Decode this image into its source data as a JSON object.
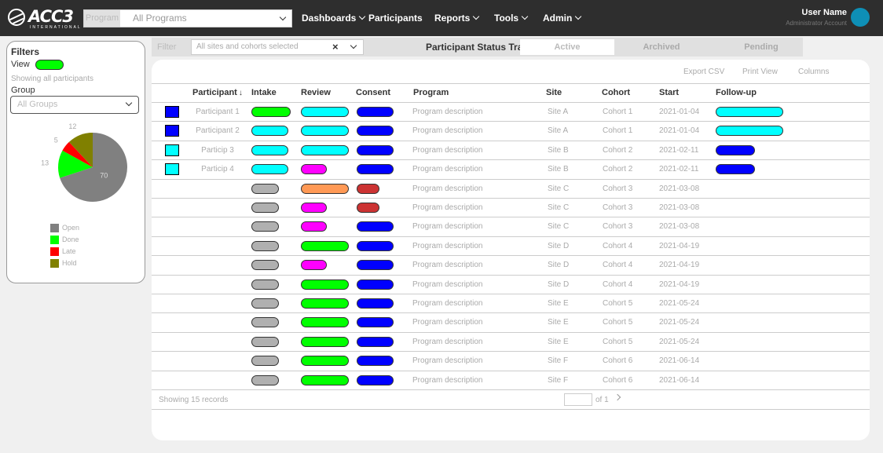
{
  "header": {
    "logo_text": "ACC3",
    "logo_subtext": "INTERNATIONAL",
    "program_label": "Program",
    "program_value": "All Programs",
    "nav": [
      {
        "label": "Dashboards",
        "has_menu": true
      },
      {
        "label": "Participants",
        "has_menu": false
      },
      {
        "label": "Reports",
        "has_menu": true
      },
      {
        "label": "Tools",
        "has_menu": true
      },
      {
        "label": "Admin",
        "has_menu": true
      }
    ],
    "user_name": "User Name",
    "user_role": "Administrator Account"
  },
  "filter_panel": {
    "title": "Filters",
    "status_key": "View",
    "status_color": "#00ff00",
    "caption": "Showing all participants",
    "group_label": "Group",
    "group_select": "All Groups",
    "pie": {
      "slices": [
        {
          "label": "Open",
          "value": 70,
          "color": "#808080"
        },
        {
          "label": "Done",
          "value": 13,
          "color": "#00ff00"
        },
        {
          "label": "Late",
          "value": 5,
          "color": "#ff0000"
        },
        {
          "label": "Hold",
          "value": 12,
          "color": "#808000"
        }
      ]
    }
  },
  "tabstrip": {
    "label": "Filter",
    "select_value": "All sites and cohorts selected",
    "clear_icon": "×",
    "title": "Participant Status Tracker",
    "tabs": [
      {
        "label": "Active",
        "active": true
      },
      {
        "label": "Archived",
        "active": false
      },
      {
        "label": "Pending",
        "active": false
      }
    ]
  },
  "table": {
    "tools": [
      "Export CSV",
      "Print View",
      "Columns"
    ],
    "columns": [
      "Participant",
      "Intake",
      "Review",
      "Consent",
      "Program",
      "Site",
      "Cohort",
      "Start",
      "Follow-up"
    ],
    "sorted_column": "Participant",
    "rows": [
      {
        "check": "#0000ff",
        "id": "Participant 1",
        "intake": "#00ff00",
        "review": "#00ffff",
        "consent": "#0000ff",
        "program": "Program description",
        "site": "Site A",
        "cohort": "Cohort 1",
        "start": "2021-01-04",
        "followup": "#00ffff"
      },
      {
        "check": "#0000ff",
        "id": "Participant 2",
        "intake": "#00ffff",
        "review": "#00ffff",
        "consent": "#0000ff",
        "program": "Program description",
        "site": "Site A",
        "cohort": "Cohort 1",
        "start": "2021-01-04",
        "followup": "#00ffff"
      },
      {
        "check": "#00ffff",
        "id": "Particip 3",
        "intake": "#00ffff",
        "review": "#00ffff",
        "consent": "#0000ff",
        "program": "Program description",
        "site": "Site B",
        "cohort": "Cohort 2",
        "start": "2021-02-11",
        "followup": "#0000ff"
      },
      {
        "check": "#00ffff",
        "id": "Particip 4",
        "intake": "#00ffff",
        "review": "#ff00ff",
        "consent": "#0000ff",
        "program": "Program description",
        "site": "Site B",
        "cohort": "Cohort 2",
        "start": "2021-02-11",
        "followup": "#0000ff"
      },
      {
        "check": null,
        "id": "",
        "intake": "#b0b0b0",
        "review": "#ff9955",
        "consent": "#cc3333",
        "program": "Program description",
        "site": "Site C",
        "cohort": "Cohort 3",
        "start": "2021-03-08",
        "followup": null
      },
      {
        "check": null,
        "id": "",
        "intake": "#b0b0b0",
        "review": "#ff00ff",
        "consent": "#cc3333",
        "program": "Program description",
        "site": "Site C",
        "cohort": "Cohort 3",
        "start": "2021-03-08",
        "followup": null
      },
      {
        "check": null,
        "id": "",
        "intake": "#b0b0b0",
        "review": "#ff00ff",
        "consent": "#0000ff",
        "program": "Program description",
        "site": "Site C",
        "cohort": "Cohort 3",
        "start": "2021-03-08",
        "followup": null
      },
      {
        "check": null,
        "id": "",
        "intake": "#b0b0b0",
        "review": "#00ff00",
        "consent": "#0000ff",
        "program": "Program description",
        "site": "Site D",
        "cohort": "Cohort 4",
        "start": "2021-04-19",
        "followup": null
      },
      {
        "check": null,
        "id": "",
        "intake": "#b0b0b0",
        "review": "#ff00ff",
        "consent": "#0000ff",
        "program": "Program description",
        "site": "Site D",
        "cohort": "Cohort 4",
        "start": "2021-04-19",
        "followup": null
      },
      {
        "check": null,
        "id": "",
        "intake": "#b0b0b0",
        "review": "#00ff00",
        "consent": "#0000ff",
        "program": "Program description",
        "site": "Site D",
        "cohort": "Cohort 4",
        "start": "2021-04-19",
        "followup": null
      },
      {
        "check": null,
        "id": "",
        "intake": "#b0b0b0",
        "review": "#00ff00",
        "consent": "#0000ff",
        "program": "Program description",
        "site": "Site E",
        "cohort": "Cohort 5",
        "start": "2021-05-24",
        "followup": null
      },
      {
        "check": null,
        "id": "",
        "intake": "#b0b0b0",
        "review": "#00ff00",
        "consent": "#0000ff",
        "program": "Program description",
        "site": "Site E",
        "cohort": "Cohort 5",
        "start": "2021-05-24",
        "followup": null
      },
      {
        "check": null,
        "id": "",
        "intake": "#b0b0b0",
        "review": "#00ff00",
        "consent": "#0000ff",
        "program": "Program description",
        "site": "Site E",
        "cohort": "Cohort 5",
        "start": "2021-05-24",
        "followup": null
      },
      {
        "check": null,
        "id": "",
        "intake": "#b0b0b0",
        "review": "#00ff00",
        "consent": "#0000ff",
        "program": "Program description",
        "site": "Site F",
        "cohort": "Cohort 6",
        "start": "2021-06-14",
        "followup": null
      },
      {
        "check": null,
        "id": "",
        "intake": "#b0b0b0",
        "review": "#00ff00",
        "consent": "#0000ff",
        "program": "Program description",
        "site": "Site F",
        "cohort": "Cohort 6",
        "start": "2021-06-14",
        "followup": null
      }
    ],
    "footer_count": "Showing 15 records",
    "pager_page": "1",
    "pager_of": "of 1"
  }
}
